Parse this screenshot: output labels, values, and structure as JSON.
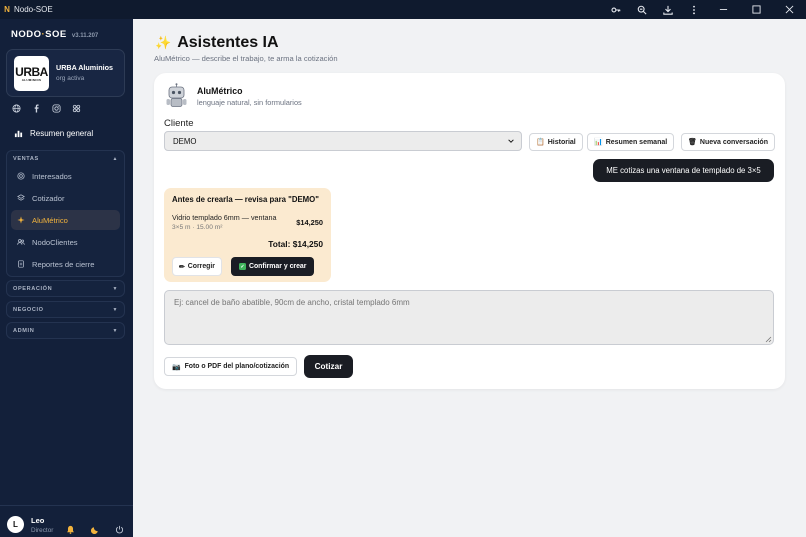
{
  "window": {
    "title": "Nodo-SOE",
    "icons": [
      "key-icon",
      "zoom-icon",
      "download-icon",
      "more-vertical-icon"
    ],
    "controls": [
      "minimize-icon",
      "maximize-icon",
      "close-icon"
    ]
  },
  "sidebar": {
    "brand_left": "NODO",
    "brand_dot": "·",
    "brand_right": "SOE",
    "version": "v3.11.207",
    "org": {
      "logo_text": "URBA",
      "logo_sub": "ALUMINIOS",
      "name": "URBA Aluminios",
      "status": "org activa"
    },
    "social_icons": [
      "globe-icon",
      "facebook-icon",
      "instagram-icon",
      "tiktok-icon"
    ],
    "overview_label": "Resumen general",
    "sections": {
      "ventas": {
        "label": "VENTAS",
        "items": [
          {
            "label": "Interesados",
            "icon": "target-icon"
          },
          {
            "label": "Cotizador",
            "icon": "layers-icon"
          },
          {
            "label": "AluMétrico",
            "icon": "sparkle-icon",
            "active": true
          },
          {
            "label": "NodoClientes",
            "icon": "users-icon"
          },
          {
            "label": "Reportes de cierre",
            "icon": "document-icon"
          }
        ]
      },
      "operacion": {
        "label": "OPERACIÓN"
      },
      "negocio": {
        "label": "NEGOCIO"
      },
      "admin": {
        "label": "ADMIN"
      }
    },
    "user": {
      "initial": "L",
      "name": "Leo",
      "role": "Director",
      "icons": [
        "bell-icon",
        "moon-icon",
        "power-icon"
      ]
    }
  },
  "main": {
    "title": "Asistentes IA",
    "title_icon": "✨",
    "subtitle": "AluMétrico — describe el trabajo, te arma la cotización",
    "assistant": {
      "name": "AluMétrico",
      "description": "lenguaje natural, sin formularios"
    },
    "client_label": "Cliente",
    "client_value": "DEMO",
    "buttons": {
      "history": "Historial",
      "weekly": "Resumen semanal",
      "new_chat": "Nueva conversación"
    },
    "user_message": "ME cotizas una ventana de templado de 3×5",
    "confirm": {
      "title": "Antes de crearla — revisa para \"DEMO\"",
      "item": "Vidrio templado 6mm — ventana",
      "meta": "3×5 m · 15.00 m²",
      "price": "$14,250",
      "total": "Total: $14,250",
      "edit_label": "Corregir",
      "confirm_label": "Confirmar y crear"
    },
    "input_placeholder": "Ej: cancel de baño abatible, 90cm de ancho, cristal templado 6mm",
    "photo_button": "Foto o PDF del plano/cotización",
    "quote_button": "Cotizar"
  },
  "colors": {
    "sidebar_bg": "#13203a",
    "accent": "#f2b33d",
    "dark_button": "#1a1d24",
    "confirm_bg": "#fbead0"
  }
}
